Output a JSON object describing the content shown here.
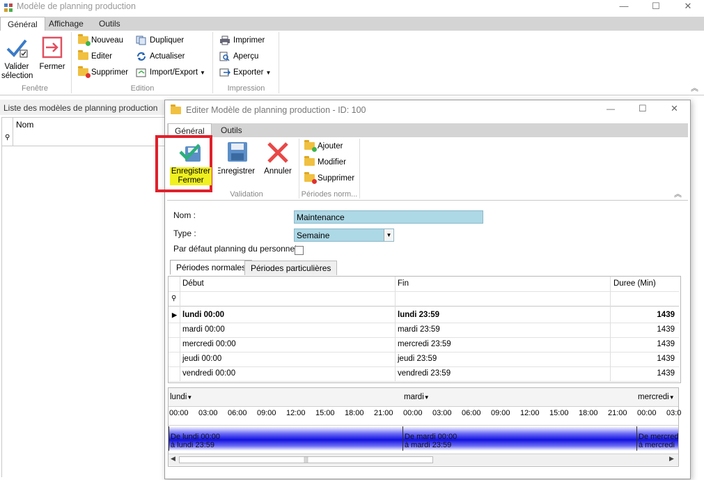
{
  "main": {
    "title": "Modèle de planning production",
    "tabs": [
      "Général",
      "Affichage",
      "Outils"
    ],
    "ribbon": {
      "fenetre": {
        "label": "Fenêtre",
        "valider": "Valider sélection",
        "fermer": "Fermer"
      },
      "edition": {
        "label": "Edition",
        "nouveau": "Nouveau",
        "editer": "Editer",
        "supprimer": "Supprimer",
        "dupliquer": "Dupliquer",
        "actualiser": "Actualiser",
        "import_export": "Import/Export"
      },
      "impression": {
        "label": "Impression",
        "imprimer": "Imprimer",
        "apercu": "Aperçu",
        "exporter": "Exporter"
      }
    },
    "list": {
      "title": "Liste des modèles de planning production",
      "column": "Nom"
    }
  },
  "dialog": {
    "title": "Editer Modèle de planning production - ID: 100",
    "tabs": [
      "Général",
      "Outils"
    ],
    "ribbon": {
      "validation": {
        "label": "Validation",
        "save_close_1": "Enregistrer",
        "save_close_2": "Fermer",
        "save": "Enregistrer",
        "cancel": "Annuler"
      },
      "periodes": {
        "label": "Périodes norm...",
        "ajouter": "Ajouter",
        "modifier": "Modifier",
        "supprimer": "Supprimer"
      }
    },
    "form": {
      "nom_label": "Nom :",
      "nom_value": "Maintenance",
      "type_label": "Type :",
      "type_value": "Semaine",
      "defaut_label": "Par défaut planning du personnel :"
    },
    "subtabs": [
      "Périodes normales",
      "Périodes particulières"
    ],
    "grid": {
      "columns": [
        "Début",
        "Fin",
        "Duree (Min)"
      ],
      "rows": [
        {
          "debut": "lundi 00:00",
          "fin": "lundi 23:59",
          "duree": "1439"
        },
        {
          "debut": "mardi 00:00",
          "fin": "mardi 23:59",
          "duree": "1439"
        },
        {
          "debut": "mercredi 00:00",
          "fin": "mercredi 23:59",
          "duree": "1439"
        },
        {
          "debut": "jeudi 00:00",
          "fin": "jeudi 23:59",
          "duree": "1439"
        },
        {
          "debut": "vendredi 00:00",
          "fin": "vendredi 23:59",
          "duree": "1439"
        }
      ]
    },
    "schedule": {
      "days": [
        "lundi",
        "mardi",
        "mercredi"
      ],
      "hours": [
        "00:00",
        "03:00",
        "06:00",
        "09:00",
        "12:00",
        "15:00",
        "18:00",
        "21:00",
        "00:00",
        "03:00",
        "06:00",
        "09:00",
        "12:00",
        "15:00",
        "18:00",
        "21:00",
        "00:00",
        "03:0"
      ],
      "bars": [
        {
          "l1": "De lundi 00:00",
          "l2": "à lundi 23:59"
        },
        {
          "l1": "De mardi 00:00",
          "l2": "à mardi 23:59"
        },
        {
          "l1": "De mercredi",
          "l2": "à mercredi"
        }
      ]
    }
  }
}
